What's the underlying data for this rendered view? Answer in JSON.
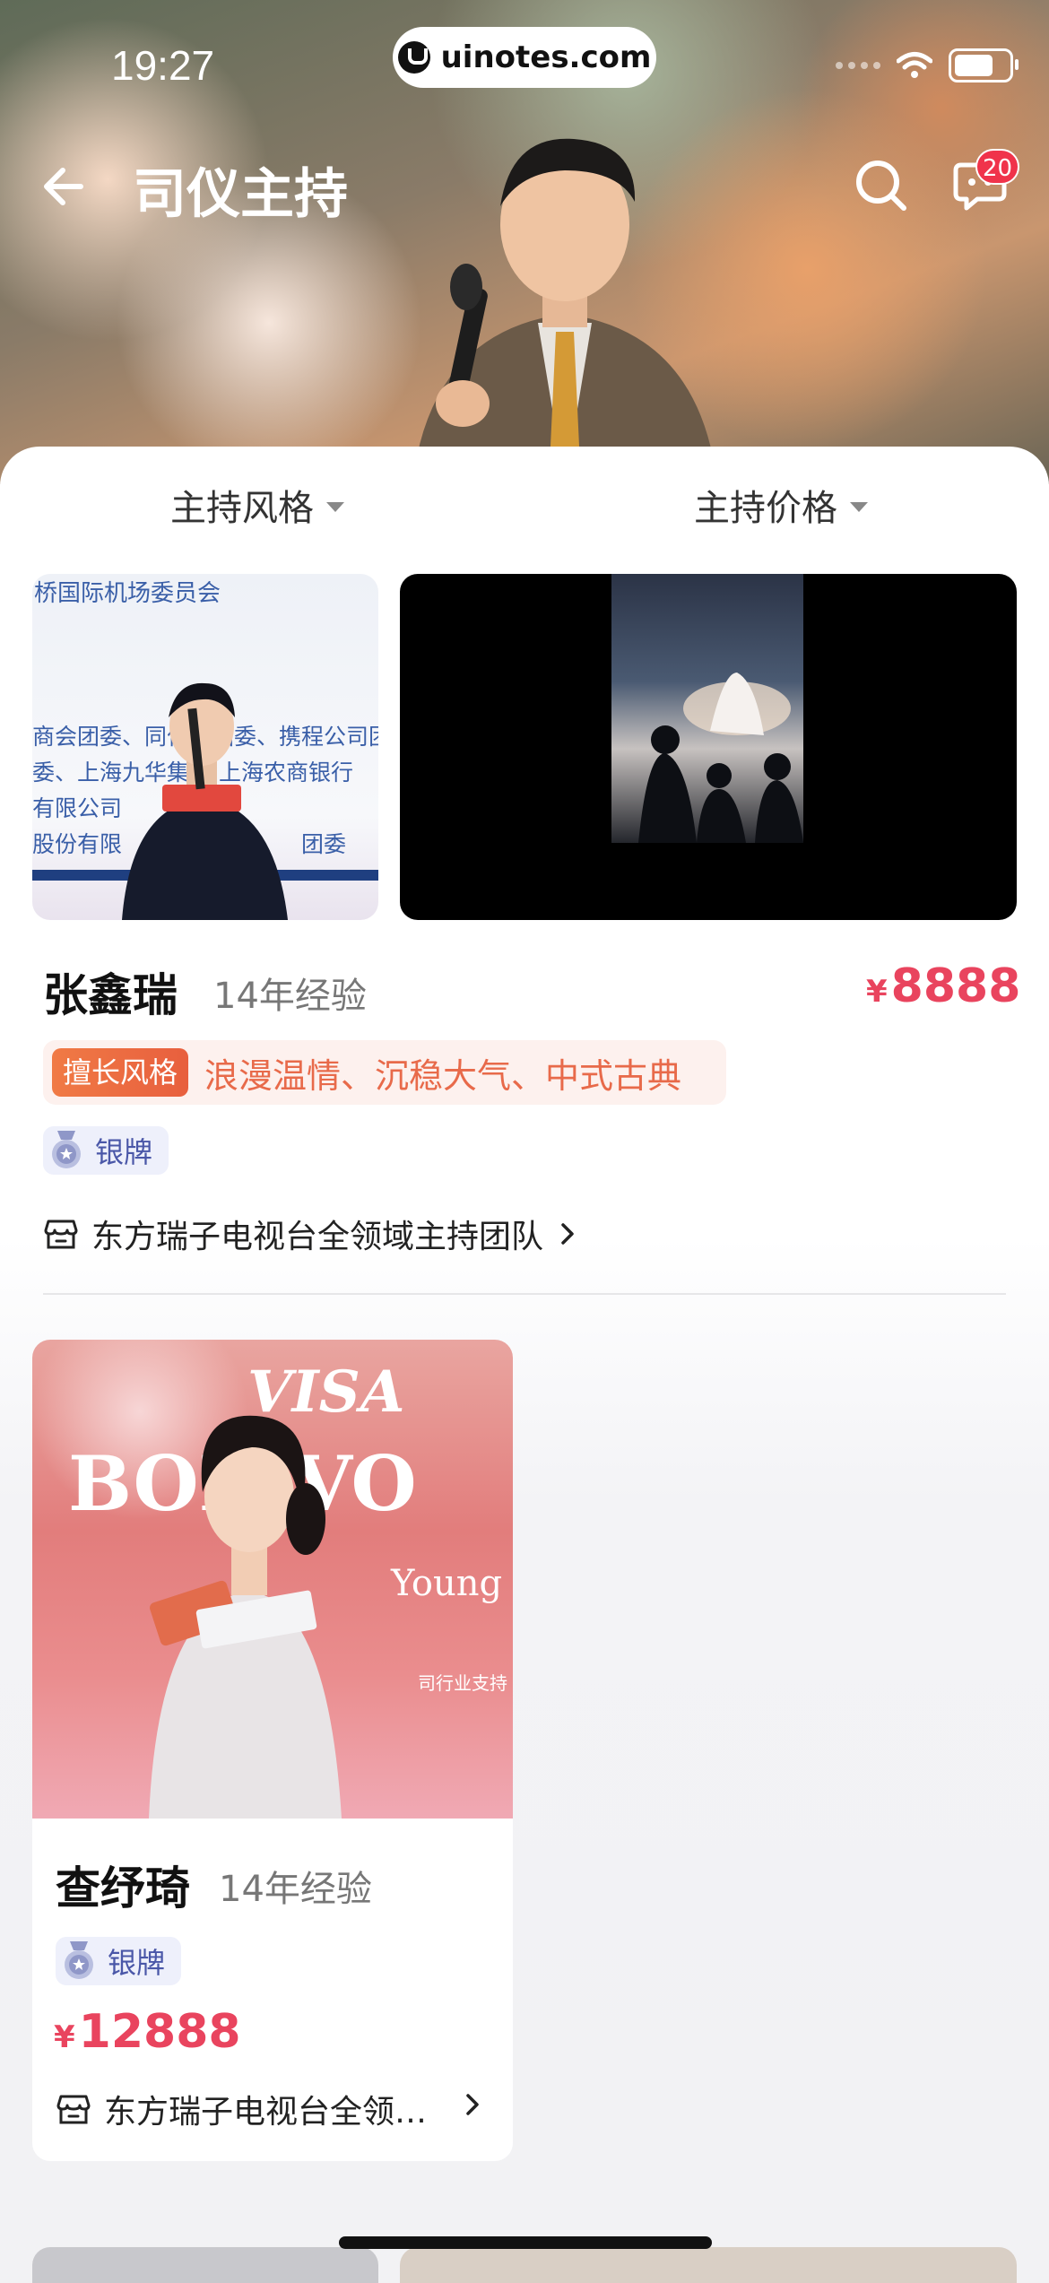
{
  "status_bar": {
    "time": "19:27",
    "url": "uinotes.com"
  },
  "nav": {
    "title": "司仪主持",
    "message_count": "20"
  },
  "filters": [
    {
      "label": "主持风格"
    },
    {
      "label": "主持价格"
    }
  ],
  "card1": {
    "image1_text": [
      "桥国际机场委员会",
      "商会团委、同仁医团委、携程公司团",
      "委、上海九华集团 上海农商银行",
      "有限公司",
      "股份有限",
      "团委"
    ],
    "name": "张鑫瑞",
    "experience": "14年经验",
    "price_currency": "¥",
    "price_value": "8888",
    "style_tag": "擅长风格",
    "styles": "浪漫温情、沉稳大气、中式古典",
    "medal": "银牌",
    "team": "东方瑞子电视台全领域主持团队"
  },
  "card2": {
    "image_text": [
      "VISA",
      "BON VO",
      "Young",
      "司行业支持"
    ],
    "name": "查纾琦",
    "experience": "14年经验",
    "medal": "银牌",
    "price_currency": "¥",
    "price_value": "12888",
    "team": "东方瑞子电视台全领…"
  },
  "colors": {
    "accent_red": "#e9445e",
    "tag_orange": "#e85f3e",
    "medal_blue": "#4a57a8"
  },
  "icons": [
    "back-arrow-icon",
    "search-icon",
    "chat-icon",
    "dropdown-caret-icon",
    "silver-medal-icon",
    "shop-icon",
    "chevron-right-icon"
  ]
}
